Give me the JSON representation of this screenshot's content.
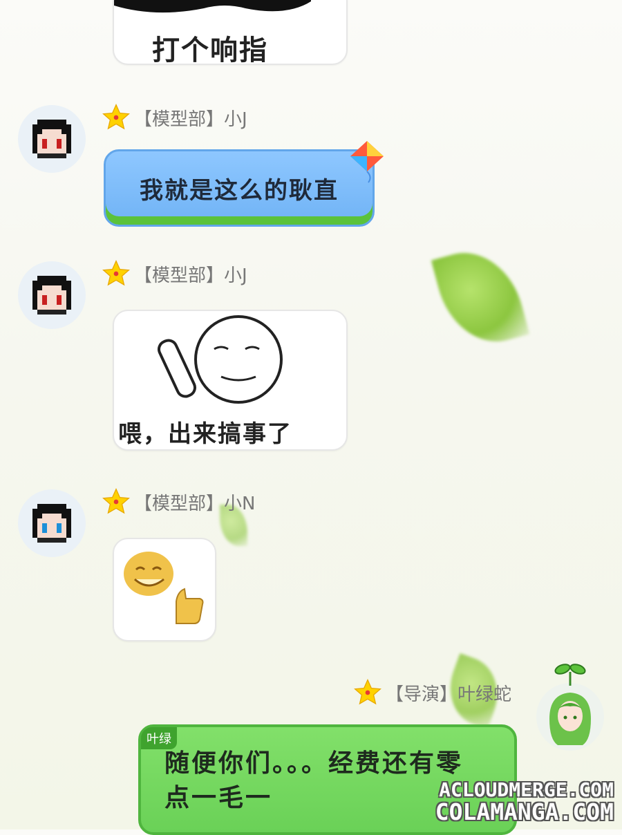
{
  "messages": [
    {
      "sticker_caption": "打个响指"
    },
    {
      "role": "【模型部】",
      "name": "小J",
      "text": "我就是这么的耿直"
    },
    {
      "role": "【模型部】",
      "name": "小J",
      "sticker_caption": "喂，出来搞事了"
    },
    {
      "role": "【模型部】",
      "name": "小N"
    },
    {
      "role": "【导演】",
      "name": "叶绿蛇",
      "tag": "叶绿",
      "text": "随便你们。。。经费还有零点一毛一"
    }
  ],
  "watermark": {
    "line1": "ACLOUDMERGE.COM",
    "line2": "COLAMANGA.COM"
  },
  "colors": {
    "blue_bubble": "#70b3f5",
    "green_bubble": "#6ad157",
    "star": "#ffd200"
  }
}
